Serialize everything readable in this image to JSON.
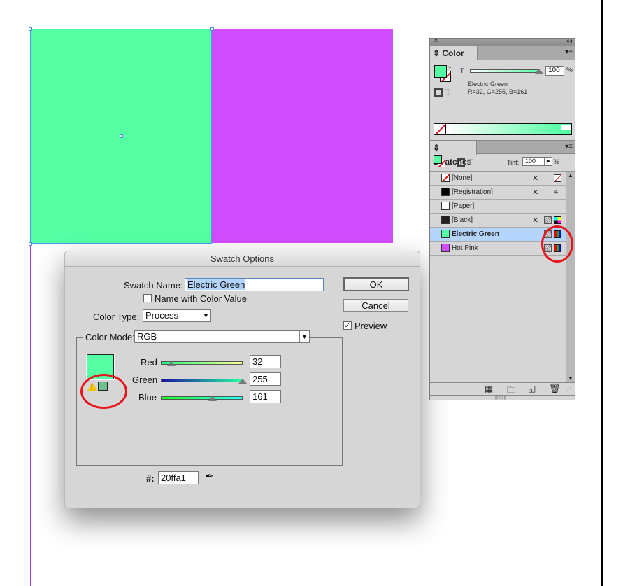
{
  "canvas": {
    "objects": [
      {
        "name": "Electric Green",
        "fill": "#55ffa4",
        "selected": true
      },
      {
        "name": "Hot Pink",
        "fill": "#d24cff",
        "selected": false
      }
    ]
  },
  "dialog": {
    "title": "Swatch Options",
    "swatch_name_label": "Swatch Name:",
    "swatch_name_value": "Electric Green",
    "name_with_color_value_label": "Name with Color Value",
    "name_with_color_value_checked": false,
    "color_type_label": "Color Type:",
    "color_type_value": "Process",
    "color_mode_label": "Color Mode:",
    "color_mode_value": "RGB",
    "sliders": [
      {
        "label": "Red",
        "value": "32"
      },
      {
        "label": "Green",
        "value": "255"
      },
      {
        "label": "Blue",
        "value": "161"
      }
    ],
    "hex_label": "#:",
    "hex_value": "20ffa1",
    "ok_label": "OK",
    "cancel_label": "Cancel",
    "preview_label": "Preview",
    "preview_checked": true,
    "gamut_warning_icon": "warning-icon",
    "preview_color": "#55ffa4",
    "gamut_color": "#6fc090"
  },
  "color_panel": {
    "tab": "Color",
    "tint_label": "T",
    "tint_value": "100",
    "percent": "%",
    "swatch_name": "Electric Green",
    "rgb_text": "R=32, G=255, B=161"
  },
  "swatches_panel": {
    "tab": "Swatches",
    "tint_label": "Tint:",
    "tint_value": "100",
    "percent": "%",
    "items": [
      {
        "label": "[None]",
        "color": "none",
        "selected": false
      },
      {
        "label": "[Registration]",
        "color": "#000000",
        "selected": false
      },
      {
        "label": "[Paper]",
        "color": "#ffffff",
        "selected": false
      },
      {
        "label": "[Black]",
        "color": "#231f20",
        "selected": false
      },
      {
        "label": "Electric Green",
        "color": "#55ffa4",
        "selected": true
      },
      {
        "label": "Hot Pink",
        "color": "#d24cff",
        "selected": false
      }
    ]
  }
}
